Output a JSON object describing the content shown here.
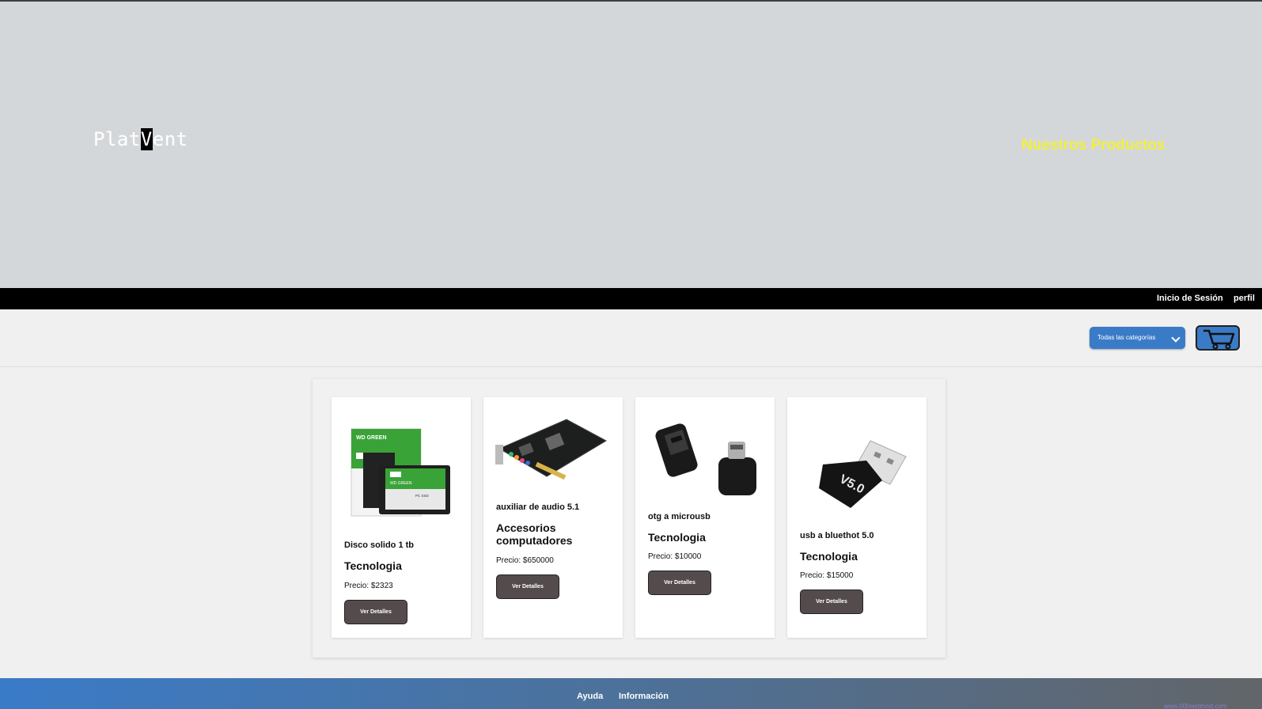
{
  "header": {
    "logo_text_before": "Plat",
    "logo_text_cursor": "V",
    "logo_text_after": "ent",
    "products_link": "Nuestros Productos"
  },
  "nav": {
    "login": "Inicio de Sesión",
    "profile": "perfil"
  },
  "toolbar": {
    "category_selected": "Todas las categorías",
    "cart_icon": "cart-icon"
  },
  "products": [
    {
      "name": "Disco solido 1 tb",
      "category": "Tecnologia",
      "price": "Precio: $2323",
      "button": "Ver Detalles",
      "image": "ssd-image"
    },
    {
      "name": "auxiliar de audio 5.1",
      "category": "Accesorios computadores",
      "price": "Precio: $650000",
      "button": "Ver Detalles",
      "image": "sound-card-image"
    },
    {
      "name": "otg a microusb",
      "category": "Tecnologia",
      "price": "Precio: $10000",
      "button": "Ver Detalles",
      "image": "otg-adapter-image"
    },
    {
      "name": "usb a bluethot 5.0",
      "category": "Tecnologia",
      "price": "Precio: $15000",
      "button": "Ver Detalles",
      "image": "bluetooth-dongle-image"
    }
  ],
  "footer": {
    "help": "Ayuda",
    "info": "Información",
    "badge_text": "www.000webhost.com"
  },
  "colors": {
    "hero_bg": "#d4d7da",
    "accent_yellow": "#f0f03c",
    "accent_blue": "#3a7bc8",
    "button_dark": "#544c4c"
  }
}
